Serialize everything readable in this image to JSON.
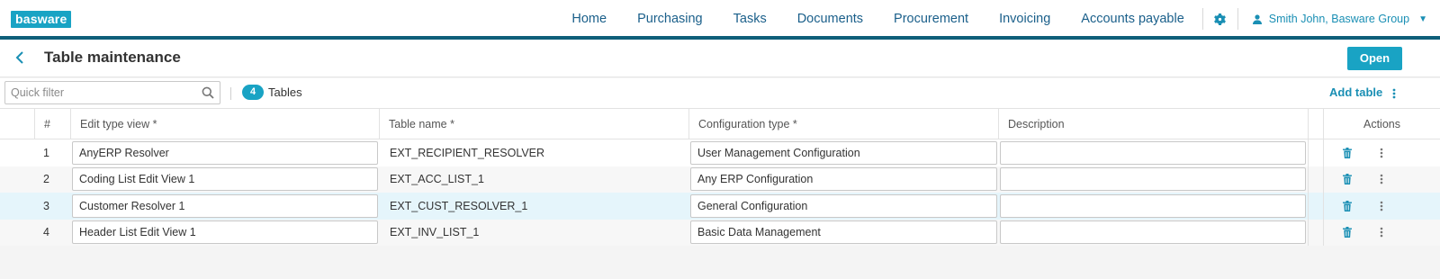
{
  "app": {
    "logo": "basware"
  },
  "nav": {
    "items": [
      "Home",
      "Purchasing",
      "Tasks",
      "Documents",
      "Procurement",
      "Invoicing",
      "Accounts payable"
    ],
    "user": "Smith John, Basware Group"
  },
  "page": {
    "title": "Table maintenance",
    "open_label": "Open"
  },
  "toolbar": {
    "filter_placeholder": "Quick filter",
    "count": "4",
    "count_label": "Tables",
    "add_table_label": "Add table"
  },
  "table": {
    "columns": [
      "#",
      "Edit type view *",
      "Table name *",
      "Configuration type *",
      "Description",
      "Actions"
    ],
    "rows": [
      {
        "num": "1",
        "edit_type_view": "AnyERP Resolver",
        "table_name": "EXT_RECIPIENT_RESOLVER",
        "config_type": "User Management Configuration",
        "description": ""
      },
      {
        "num": "2",
        "edit_type_view": "Coding List Edit View 1",
        "table_name": "EXT_ACC_LIST_1",
        "config_type": "Any ERP Configuration",
        "description": ""
      },
      {
        "num": "3",
        "edit_type_view": "Customer Resolver 1",
        "table_name": "EXT_CUST_RESOLVER_1",
        "config_type": "General Configuration",
        "description": ""
      },
      {
        "num": "4",
        "edit_type_view": "Header List Edit View 1",
        "table_name": "EXT_INV_LIST_1",
        "config_type": "Basic Data Management",
        "description": ""
      }
    ],
    "selected_row": "3"
  },
  "colors": {
    "accent": "#19a3c4",
    "dark_bar": "#0e5f7a",
    "nav_text": "#1a5f8a",
    "selected_row": "#e5f5fb"
  },
  "icons": {
    "back": "chevron-left-icon",
    "gear": "gear-icon",
    "user": "person-icon",
    "search": "search-icon",
    "delete": "trash-icon",
    "more": "more-vertical-icon"
  }
}
